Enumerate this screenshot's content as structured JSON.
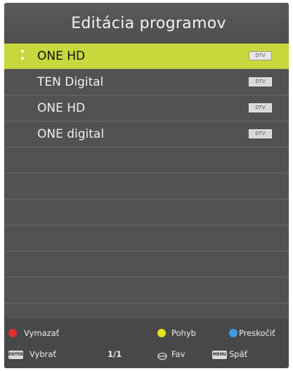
{
  "header": {
    "title": "Editácia programov"
  },
  "channels": [
    {
      "name": "ONE HD",
      "type": "DTV",
      "selected": true
    },
    {
      "name": "TEN Digital",
      "type": "DTV",
      "selected": false
    },
    {
      "name": "ONE HD",
      "type": "DTV",
      "selected": false
    },
    {
      "name": "ONE digital",
      "type": "DTV",
      "selected": false
    }
  ],
  "footer": {
    "red_label": "Vymazať",
    "yellow_label": "Pohyb",
    "blue_label": "Preskočiť",
    "enter_key": "ENTER",
    "enter_label": "Vybrať",
    "page": "1/1",
    "fav_label": "Fav",
    "menu_key": "MENU",
    "menu_label": "Späť"
  },
  "colors": {
    "selected_row": "#c6d83b",
    "red": "#e03030",
    "yellow": "#e8e020",
    "blue": "#3a9be6"
  },
  "icons": {
    "fav": "heart-icon"
  }
}
